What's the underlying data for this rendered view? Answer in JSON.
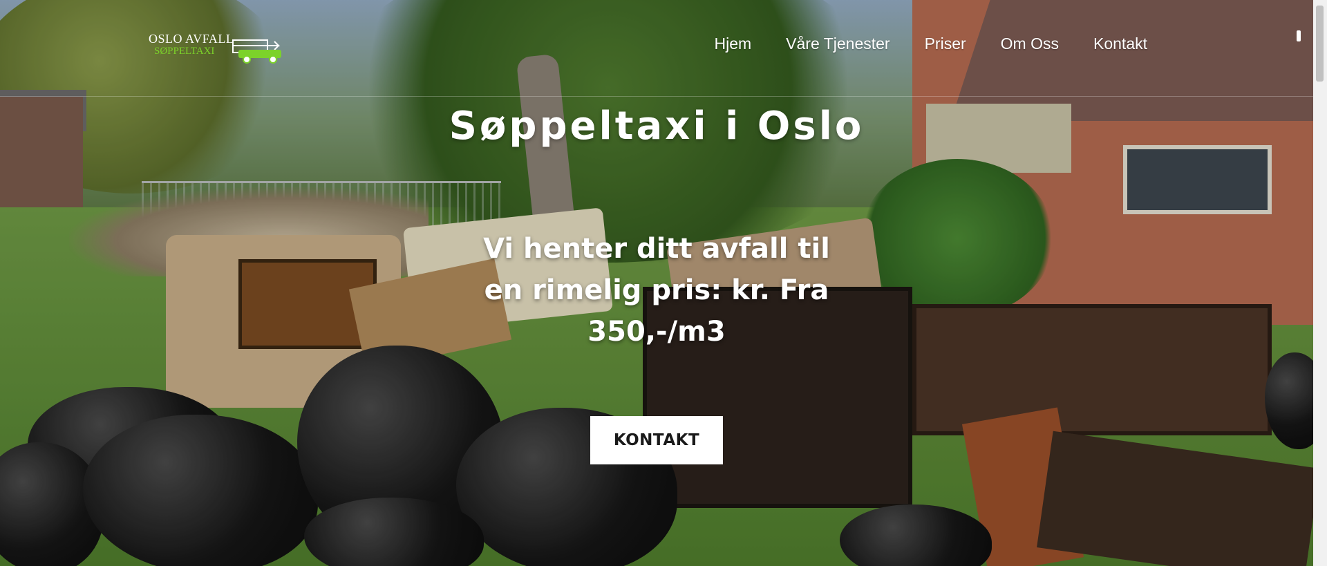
{
  "logo": {
    "name": "OSLO AVFALL",
    "sub": "SØPPELTAXI"
  },
  "nav": {
    "items": [
      {
        "label": "Hjem"
      },
      {
        "label": "Våre Tjenester"
      },
      {
        "label": "Priser"
      },
      {
        "label": "Om Oss"
      },
      {
        "label": "Kontakt"
      }
    ]
  },
  "hero": {
    "title": "Søppeltaxi i Oslo",
    "subtitle": "Vi henter ditt avfall til en rimelig pris: kr. Fra 350,-/m3",
    "cta_label": "KONTAKT"
  },
  "colors": {
    "logo_accent": "#7cd22a",
    "cta_background": "#ffffff",
    "text": "#ffffff"
  }
}
